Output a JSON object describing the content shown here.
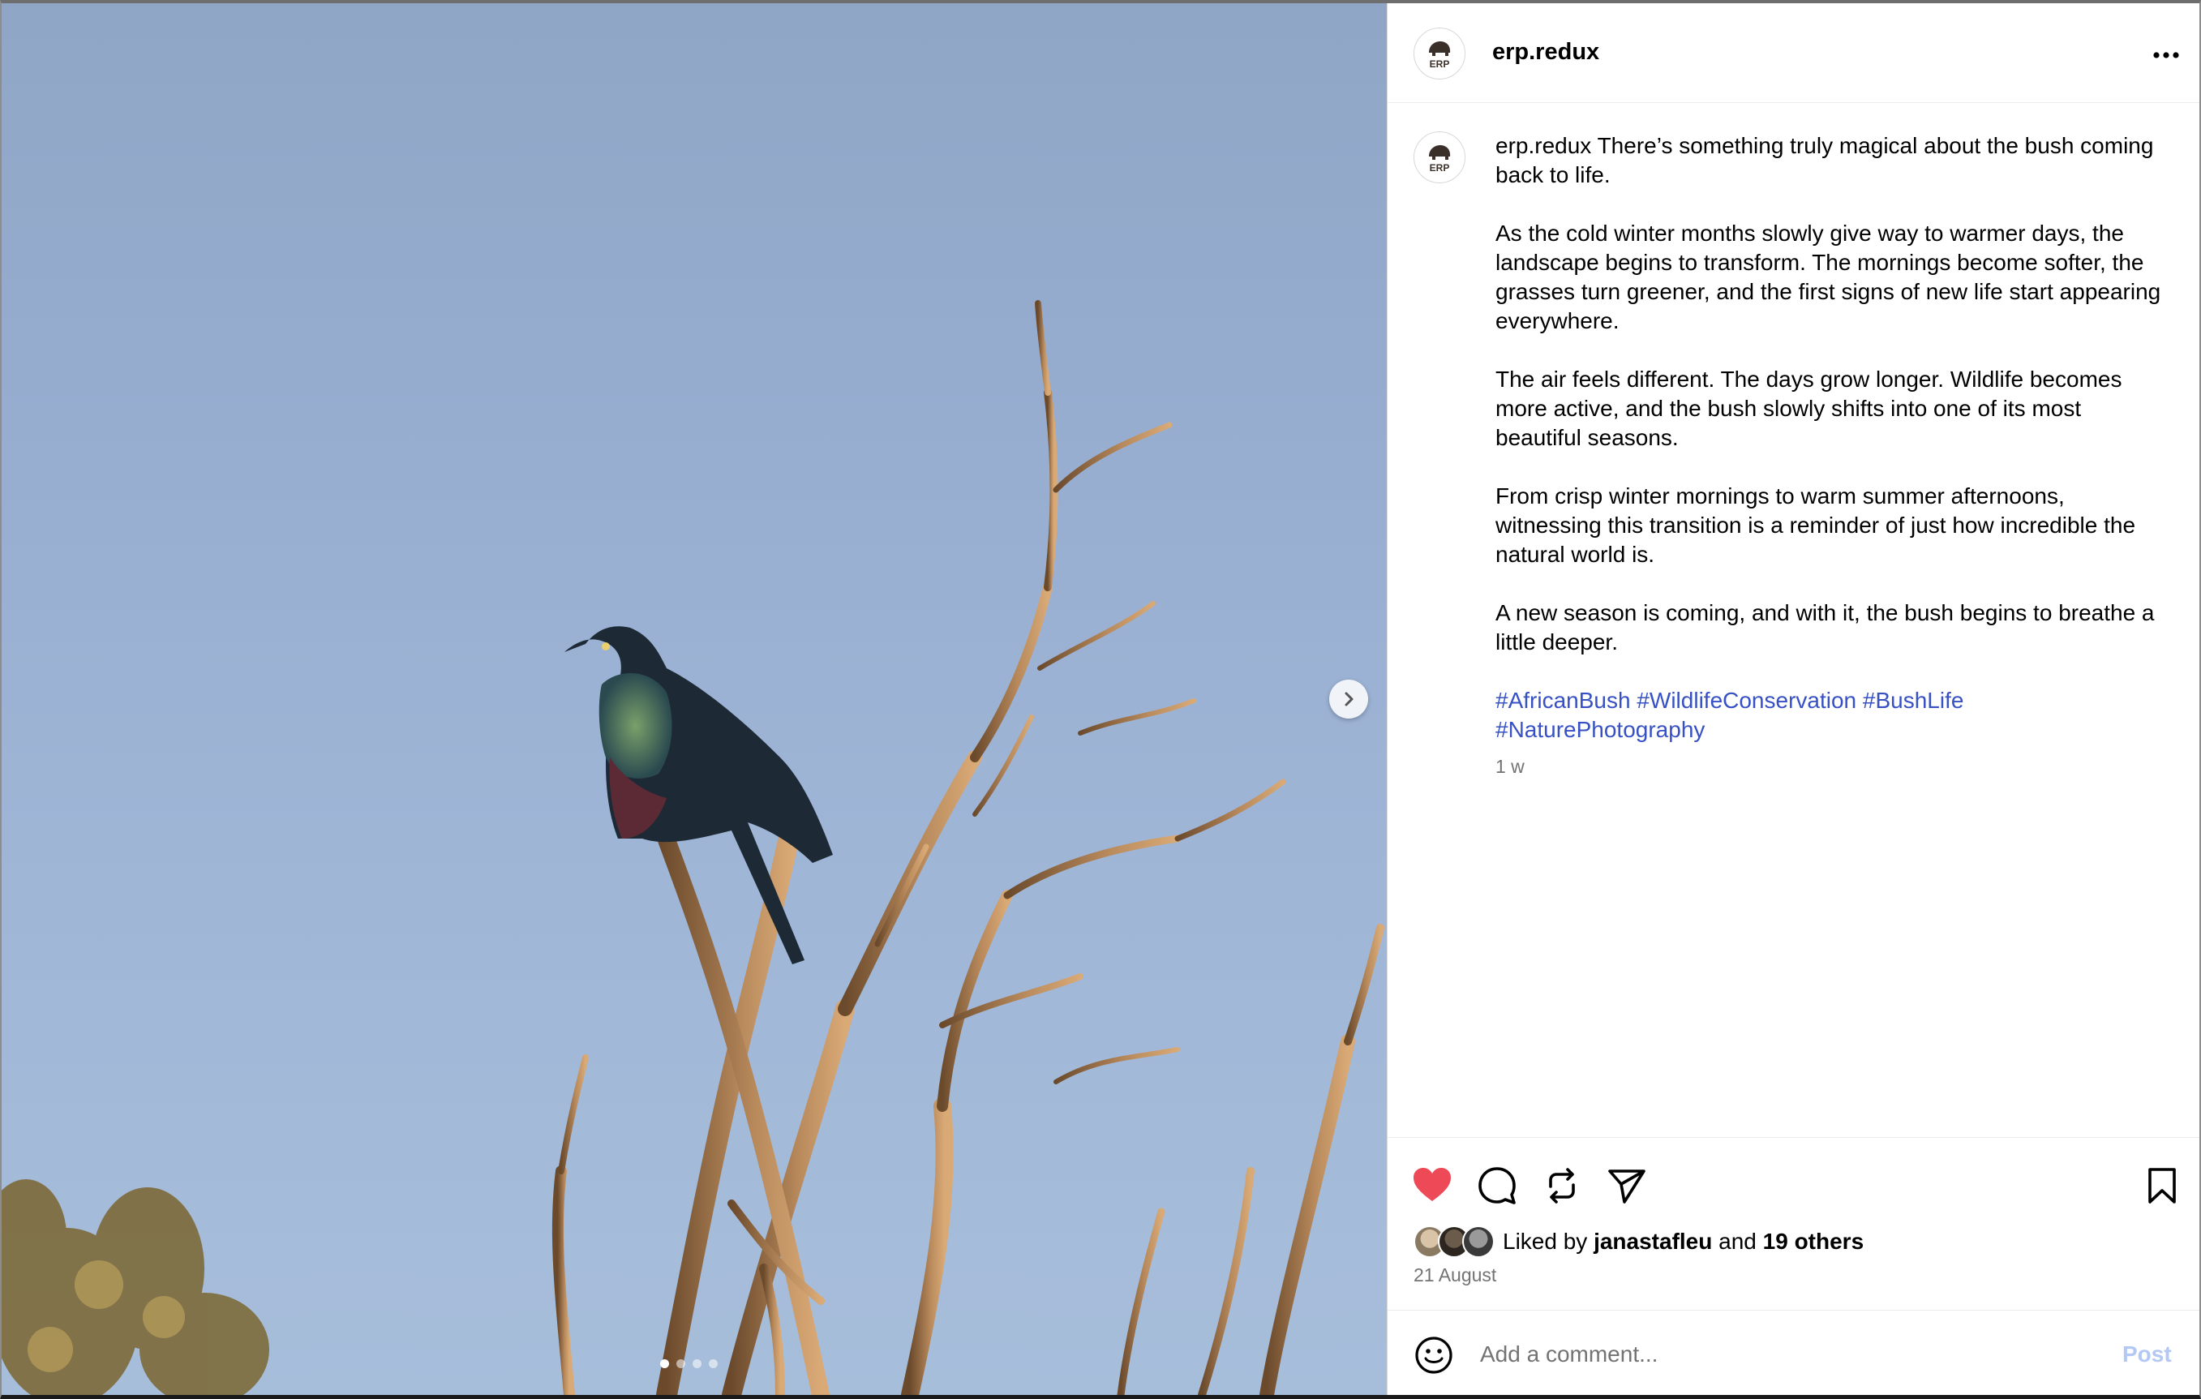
{
  "post": {
    "username": "erp.redux",
    "avatar_text": "ERP",
    "caption": {
      "user": "erp.redux",
      "p1": "There’s something truly magical about the bush coming back to life.",
      "p2": "As the cold winter months slowly give way to warmer days, the landscape begins to transform. The mornings become softer, the grasses turn greener, and the first signs of new life start appearing everywhere.",
      "p3": "The air feels different. The days grow longer. Wildlife becomes more active, and the bush slowly shifts into one of its most beautiful seasons.",
      "p4": "From crisp winter mornings to warm summer afternoons, witnessing this transition is a reminder of just how incredible the natural world is.",
      "p5": "A new season is coming, and with it, the bush begins to breathe a little deeper.",
      "hashtags": [
        "#AfricanBush",
        "#WildlifeConservation",
        "#BushLife",
        "#NaturePhotography"
      ]
    },
    "time_ago": "1 w",
    "likes": {
      "prefix": "Liked by",
      "user": "janastafleu",
      "joiner": "and",
      "others": "19 others"
    },
    "date": "21 August",
    "liked": true
  },
  "carousel": {
    "count": 4,
    "active_index": 0
  },
  "comment": {
    "placeholder": "Add a comment...",
    "post_label": "Post"
  },
  "icons": {
    "more": "more-horizontal-icon",
    "next": "chevron-right-icon",
    "like": "heart-icon",
    "comment": "comment-icon",
    "repost": "repost-icon",
    "share": "send-icon",
    "save": "bookmark-icon",
    "emoji": "emoji-icon"
  },
  "colors": {
    "like": "#ed4956",
    "hashtag": "#3751c4",
    "muted": "#737373",
    "post_disabled": "#b3c8f5"
  }
}
